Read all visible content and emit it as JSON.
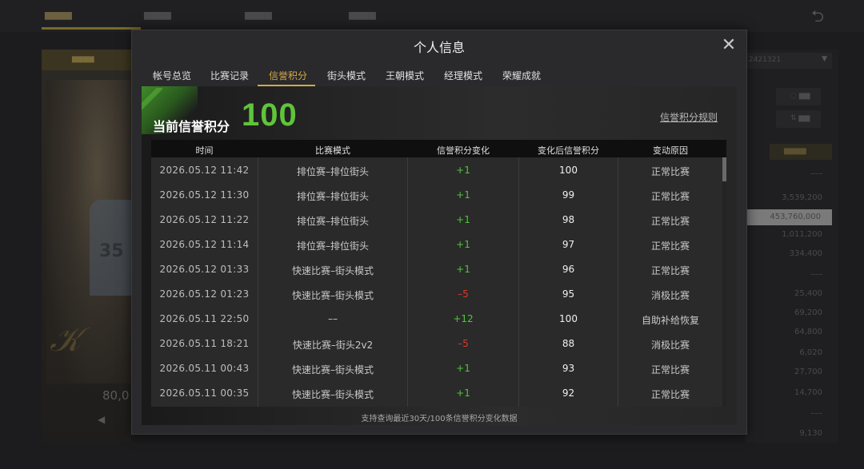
{
  "modal": {
    "title": "个人信息",
    "tabs": [
      {
        "label": "帐号总览",
        "active": false
      },
      {
        "label": "比赛记录",
        "active": false
      },
      {
        "label": "信誉积分",
        "active": true
      },
      {
        "label": "街头模式",
        "active": false
      },
      {
        "label": "王朝模式",
        "active": false
      },
      {
        "label": "经理模式",
        "active": false
      },
      {
        "label": "荣耀成就",
        "active": false
      }
    ],
    "credit_label": "当前信誉积分",
    "credit_value": "100",
    "rules_link": "信誉积分规则",
    "columns": [
      "时间",
      "比赛模式",
      "信誉积分变化",
      "变化后信誉积分",
      "变动原因"
    ],
    "rows": [
      {
        "time": "2026.05.12  11:42",
        "mode": "排位赛–排位街头",
        "delta": "+1",
        "after": "100",
        "reason": "正常比赛"
      },
      {
        "time": "2026.05.12  11:30",
        "mode": "排位赛–排位街头",
        "delta": "+1",
        "after": "99",
        "reason": "正常比赛"
      },
      {
        "time": "2026.05.12  11:22",
        "mode": "排位赛–排位街头",
        "delta": "+1",
        "after": "98",
        "reason": "正常比赛"
      },
      {
        "time": "2026.05.12  11:14",
        "mode": "排位赛–排位街头",
        "delta": "+1",
        "after": "97",
        "reason": "正常比赛"
      },
      {
        "time": "2026.05.12  01:33",
        "mode": "快速比赛–街头模式",
        "delta": "+1",
        "after": "96",
        "reason": "正常比赛"
      },
      {
        "time": "2026.05.12  01:23",
        "mode": "快速比赛–街头模式",
        "delta": "–5",
        "after": "95",
        "reason": "消极比赛"
      },
      {
        "time": "2026.05.11  22:50",
        "mode": "––",
        "delta": "+12",
        "after": "100",
        "reason": "自助补给恢复"
      },
      {
        "time": "2026.05.11  18:21",
        "mode": "快速比赛–街头2v2",
        "delta": "–5",
        "after": "88",
        "reason": "消极比赛"
      },
      {
        "time": "2026.05.11  00:43",
        "mode": "快速比赛–街头模式",
        "delta": "+1",
        "after": "93",
        "reason": "正常比赛"
      },
      {
        "time": "2026.05.11  00:35",
        "mode": "快速比赛–街头模式",
        "delta": "+1",
        "after": "92",
        "reason": "正常比赛"
      }
    ],
    "footnote": "支持查询最近30天/100条信誉积分变化数据"
  },
  "background": {
    "jersey_number": "35",
    "right_values": [
      "–––",
      "3,539,200",
      "453,760,000",
      "1,011,200",
      "334,400",
      "–––",
      "25,400",
      "69,200",
      "64,800",
      "6,020",
      "27,700",
      "14,700",
      "–––",
      "9,130"
    ]
  },
  "colors": {
    "accent_gold": "#d4a94a",
    "positive": "#4fc43a",
    "negative": "#d63a2a",
    "credit_green": "#5fc43a"
  },
  "icons": {
    "close": "close-icon",
    "back": "back-arrow-icon"
  }
}
